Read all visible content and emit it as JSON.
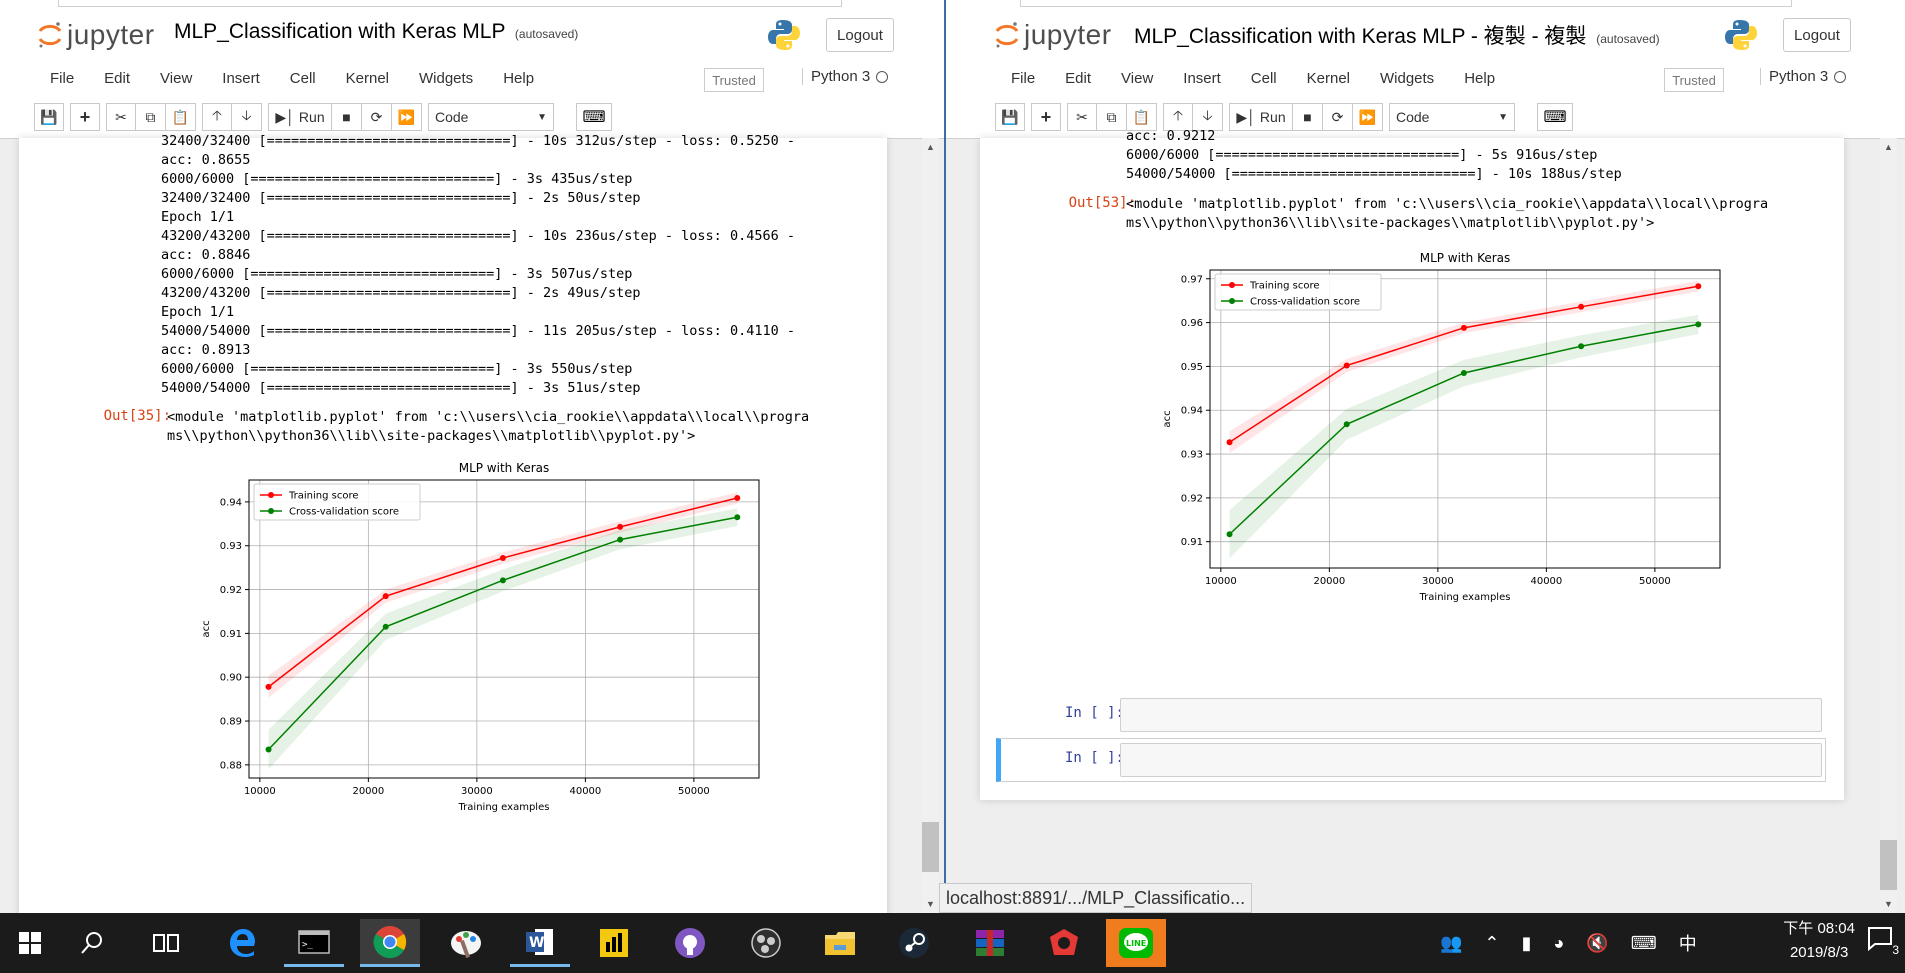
{
  "left": {
    "app_name": "jupyter",
    "notebook_title": "MLP_Classification with Keras MLP",
    "autosaved": "(autosaved)",
    "logout": "Logout",
    "menu": [
      "File",
      "Edit",
      "View",
      "Insert",
      "Cell",
      "Kernel",
      "Widgets",
      "Help"
    ],
    "trusted": "Trusted",
    "kernel": "Python 3",
    "run_label": "Run",
    "cell_type": "Code",
    "output_lines": [
      "32400/32400 [==============================] - 10s 312us/step - loss: 0.5250 -",
      "acc: 0.8655",
      "6000/6000 [==============================] - 3s 435us/step",
      "32400/32400 [==============================] - 2s 50us/step",
      "Epoch 1/1",
      "43200/43200 [==============================] - 10s 236us/step - loss: 0.4566 -",
      "acc: 0.8846",
      "6000/6000 [==============================] - 3s 507us/step",
      "43200/43200 [==============================] - 2s 49us/step",
      "Epoch 1/1",
      "54000/54000 [==============================] - 11s 205us/step - loss: 0.4110 -",
      "acc: 0.8913",
      "6000/6000 [==============================] - 3s 550us/step",
      "54000/54000 [==============================] - 3s 51us/step"
    ],
    "out_prompt": "Out[35]:",
    "module_text": "<module 'matplotlib.pyplot' from 'c:\\\\users\\\\cia_rookie\\\\appdata\\\\local\\\\progra\nms\\\\python\\\\python36\\\\lib\\\\site-packages\\\\matplotlib\\\\pyplot.py'>"
  },
  "right": {
    "app_name": "jupyter",
    "notebook_title": "MLP_Classification with Keras MLP - 複製 - 複製",
    "autosaved": "(autosaved)",
    "logout": "Logout",
    "menu": [
      "File",
      "Edit",
      "View",
      "Insert",
      "Cell",
      "Kernel",
      "Widgets",
      "Help"
    ],
    "trusted": "Trusted",
    "kernel": "Python 3",
    "run_label": "Run",
    "cell_type": "Code",
    "output_lines": [
      "acc: 0.9212",
      "6000/6000 [==============================] - 5s 916us/step",
      "54000/54000 [==============================] - 10s 188us/step"
    ],
    "out_prompt": "Out[53]:",
    "module_text": "<module 'matplotlib.pyplot' from 'c:\\\\users\\\\cia_rookie\\\\appdata\\\\local\\\\progra\nms\\\\python\\\\python36\\\\lib\\\\site-packages\\\\matplotlib\\\\pyplot.py'>",
    "in_prompt_1": "In [ ]:",
    "in_prompt_2": "In [ ]:"
  },
  "chart_data": [
    {
      "type": "line",
      "title": "MLP with Keras",
      "xlabel": "Training examples",
      "ylabel": "acc",
      "xlim": [
        9000,
        56000
      ],
      "ylim": [
        0.877,
        0.945
      ],
      "xticks": [
        10000,
        20000,
        30000,
        40000,
        50000
      ],
      "xtick_labels": [
        "10000",
        "20000",
        "30000",
        "40000",
        "50000"
      ],
      "yticks": [
        0.88,
        0.89,
        0.9,
        0.91,
        0.92,
        0.93,
        0.94
      ],
      "ytick_labels": [
        "0.88",
        "0.89",
        "0.90",
        "0.91",
        "0.92",
        "0.93",
        "0.94"
      ],
      "grid": true,
      "legend": "upper-left",
      "x": [
        10800,
        21600,
        32400,
        43200,
        54000
      ],
      "series": [
        {
          "name": "Training score",
          "color": "#ff0000",
          "values": [
            0.8978,
            0.9185,
            0.9272,
            0.9343,
            0.9409
          ],
          "band": [
            0.0025,
            0.0015,
            0.0013,
            0.0013,
            0.0013
          ]
        },
        {
          "name": "Cross-validation score",
          "color": "#008000",
          "values": [
            0.8835,
            0.9115,
            0.9221,
            0.9314,
            0.9365
          ],
          "band": [
            0.0045,
            0.003,
            0.0025,
            0.0022,
            0.002
          ]
        }
      ]
    },
    {
      "type": "line",
      "title": "MLP with Keras",
      "xlabel": "Training examples",
      "ylabel": "acc",
      "xlim": [
        9000,
        56000
      ],
      "ylim": [
        0.904,
        0.972
      ],
      "xticks": [
        10000,
        20000,
        30000,
        40000,
        50000
      ],
      "xtick_labels": [
        "10000",
        "20000",
        "30000",
        "40000",
        "50000"
      ],
      "yticks": [
        0.91,
        0.92,
        0.93,
        0.94,
        0.95,
        0.96,
        0.97
      ],
      "ytick_labels": [
        "0.91",
        "0.92",
        "0.93",
        "0.94",
        "0.95",
        "0.96",
        "0.97"
      ],
      "grid": true,
      "legend": "upper-left",
      "x": [
        10800,
        21600,
        32400,
        43200,
        54000
      ],
      "series": [
        {
          "name": "Training score",
          "color": "#ff0000",
          "values": [
            0.9327,
            0.9502,
            0.9588,
            0.9636,
            0.9683
          ],
          "band": [
            0.0025,
            0.0015,
            0.0012,
            0.0012,
            0.0012
          ]
        },
        {
          "name": "Cross-validation score",
          "color": "#008000",
          "values": [
            0.9117,
            0.9368,
            0.9485,
            0.9546,
            0.9596
          ],
          "band": [
            0.0055,
            0.0035,
            0.003,
            0.0025,
            0.0022
          ]
        }
      ]
    }
  ],
  "status_url": "localhost:8891/.../MLP_Classificatio...",
  "taskbar": {
    "clock_time": "下午 08:04",
    "clock_date": "2019/8/3",
    "ime": "中",
    "notification_count": "3",
    "apps": [
      "start-icon",
      "search-icon",
      "task-view-icon",
      "edge-icon",
      "cmd-icon",
      "chrome-icon",
      "paint-icon",
      "word-icon",
      "powerbi-icon",
      "github-icon",
      "obs-icon",
      "explorer-icon",
      "steam-icon",
      "winrar-icon",
      "garena-icon",
      "line-icon"
    ]
  }
}
